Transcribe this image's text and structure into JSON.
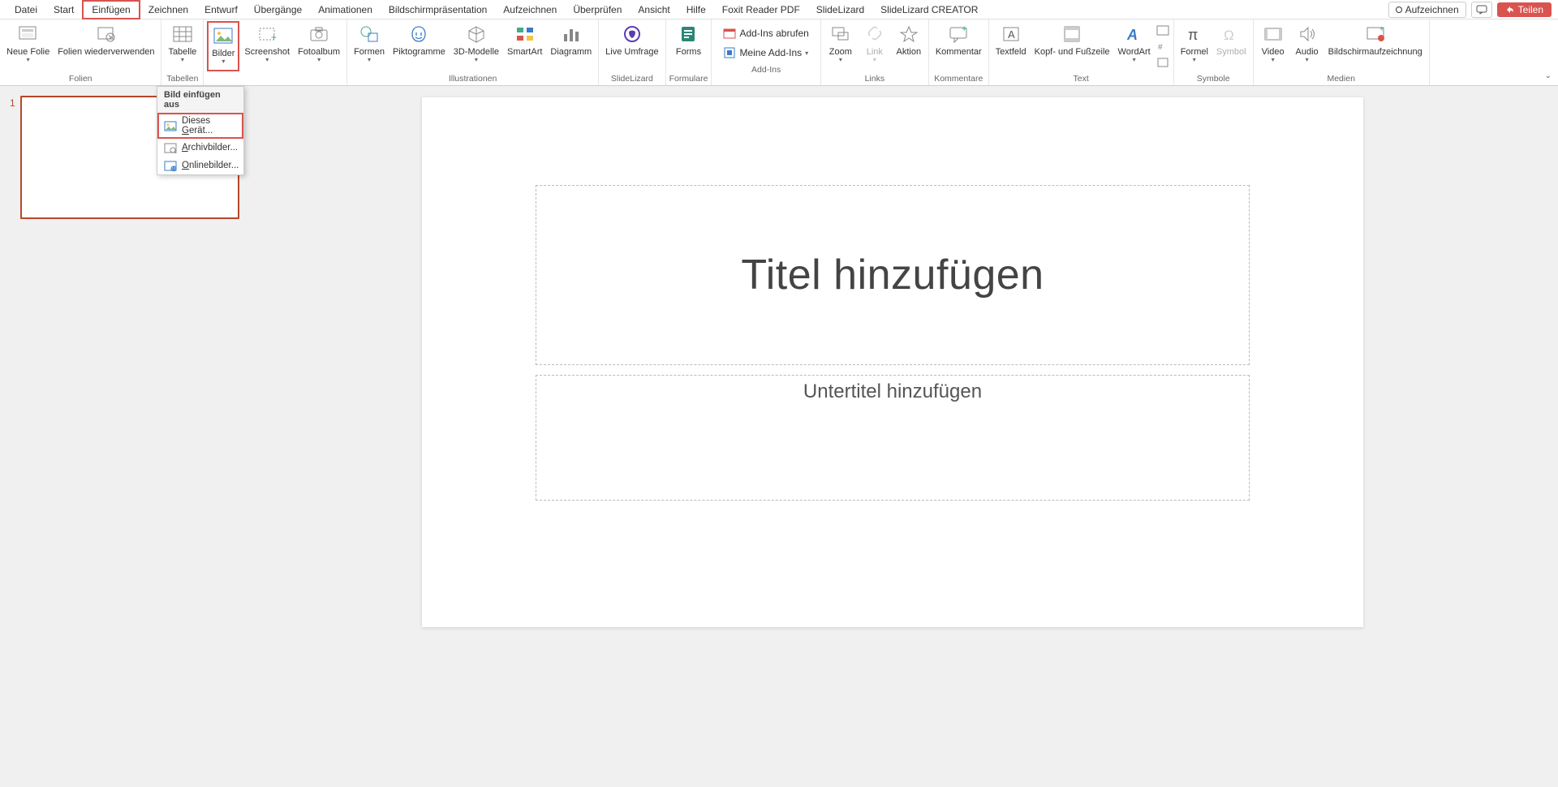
{
  "menu": {
    "tabs": [
      "Datei",
      "Start",
      "Einfügen",
      "Zeichnen",
      "Entwurf",
      "Übergänge",
      "Animationen",
      "Bildschirmpräsentation",
      "Aufzeichnen",
      "Überprüfen",
      "Ansicht",
      "Hilfe",
      "Foxit Reader PDF",
      "SlideLizard",
      "SlideLizard CREATOR"
    ],
    "active_tab": "Einfügen",
    "record": "Aufzeichnen",
    "share": "Teilen"
  },
  "ribbon": {
    "groups": {
      "folien": {
        "label": "Folien",
        "neue_folie": "Neue Folie",
        "wiederverwenden": "Folien wiederverwenden"
      },
      "tabellen": {
        "label": "Tabellen",
        "tabelle": "Tabelle"
      },
      "bilder_group": {
        "bilder": "Bilder",
        "screenshot": "Screenshot",
        "fotoalbum": "Fotoalbum"
      },
      "illustrationen": {
        "label": "Illustrationen",
        "formen": "Formen",
        "piktogramme": "Piktogramme",
        "modelle": "3D-Modelle",
        "smartart": "SmartArt",
        "diagramm": "Diagramm"
      },
      "slidelizard": {
        "label": "SlideLizard",
        "live": "Live Umfrage"
      },
      "formulare": {
        "label": "Formulare",
        "forms": "Forms"
      },
      "addins": {
        "label": "Add-Ins",
        "abrufen": "Add-Ins abrufen",
        "meine": "Meine Add-Ins"
      },
      "links": {
        "label": "Links",
        "zoom": "Zoom",
        "link": "Link",
        "aktion": "Aktion"
      },
      "kommentare": {
        "label": "Kommentare",
        "kommentar": "Kommentar"
      },
      "text": {
        "label": "Text",
        "textfeld": "Textfeld",
        "kopf": "Kopf- und Fußzeile",
        "wordart": "WordArt"
      },
      "symbole": {
        "label": "Symbole",
        "formel": "Formel",
        "symbol": "Symbol"
      },
      "medien": {
        "label": "Medien",
        "video": "Video",
        "audio": "Audio",
        "aufz": "Bildschirmaufzeichnung"
      }
    }
  },
  "dropdown": {
    "header": "Bild einfügen aus",
    "this_device_pre": "Dieses ",
    "this_device_ul": "G",
    "this_device_post": "erät...",
    "archiv_ul": "A",
    "archiv_post": "rchivbilder...",
    "online_ul": "O",
    "online_post": "nlinebilder..."
  },
  "thumbs": {
    "n1": "1"
  },
  "slide": {
    "title": "Titel hinzufügen",
    "subtitle": "Untertitel hinzufügen"
  }
}
